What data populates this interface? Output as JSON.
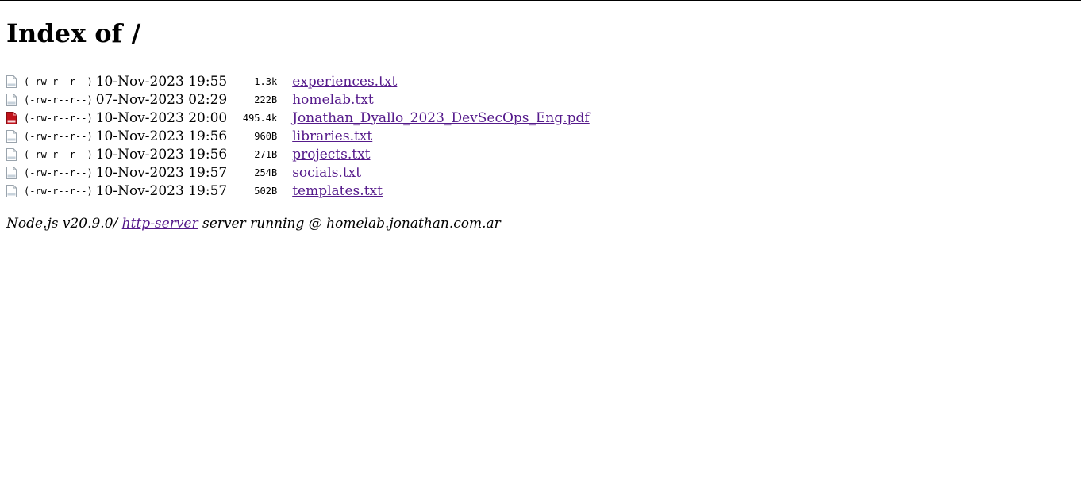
{
  "page": {
    "title": "Index of /"
  },
  "files": [
    {
      "icon": "text-file-icon",
      "perm": "(-rw-r--r--)",
      "date": "10-Nov-2023 19:55",
      "size": "1.3k",
      "name": "experiences.txt"
    },
    {
      "icon": "text-file-icon",
      "perm": "(-rw-r--r--)",
      "date": "07-Nov-2023 02:29",
      "size": "222B",
      "name": "homelab.txt"
    },
    {
      "icon": "pdf-file-icon",
      "perm": "(-rw-r--r--)",
      "date": "10-Nov-2023 20:00",
      "size": "495.4k",
      "name": "Jonathan_Dyallo_2023_DevSecOps_Eng.pdf"
    },
    {
      "icon": "text-file-icon",
      "perm": "(-rw-r--r--)",
      "date": "10-Nov-2023 19:56",
      "size": "960B",
      "name": "libraries.txt"
    },
    {
      "icon": "text-file-icon",
      "perm": "(-rw-r--r--)",
      "date": "10-Nov-2023 19:56",
      "size": "271B",
      "name": "projects.txt"
    },
    {
      "icon": "text-file-icon",
      "perm": "(-rw-r--r--)",
      "date": "10-Nov-2023 19:57",
      "size": "254B",
      "name": "socials.txt"
    },
    {
      "icon": "text-file-icon",
      "perm": "(-rw-r--r--)",
      "date": "10-Nov-2023 19:57",
      "size": "502B",
      "name": "templates.txt"
    }
  ],
  "footer": {
    "prefix": "Node.js v20.9.0/ ",
    "link": "http-server",
    "suffix": " server running @ homelab.jonathan.com.ar"
  },
  "colors": {
    "link": "#551a8b",
    "pdf_icon": "#c0121b"
  }
}
